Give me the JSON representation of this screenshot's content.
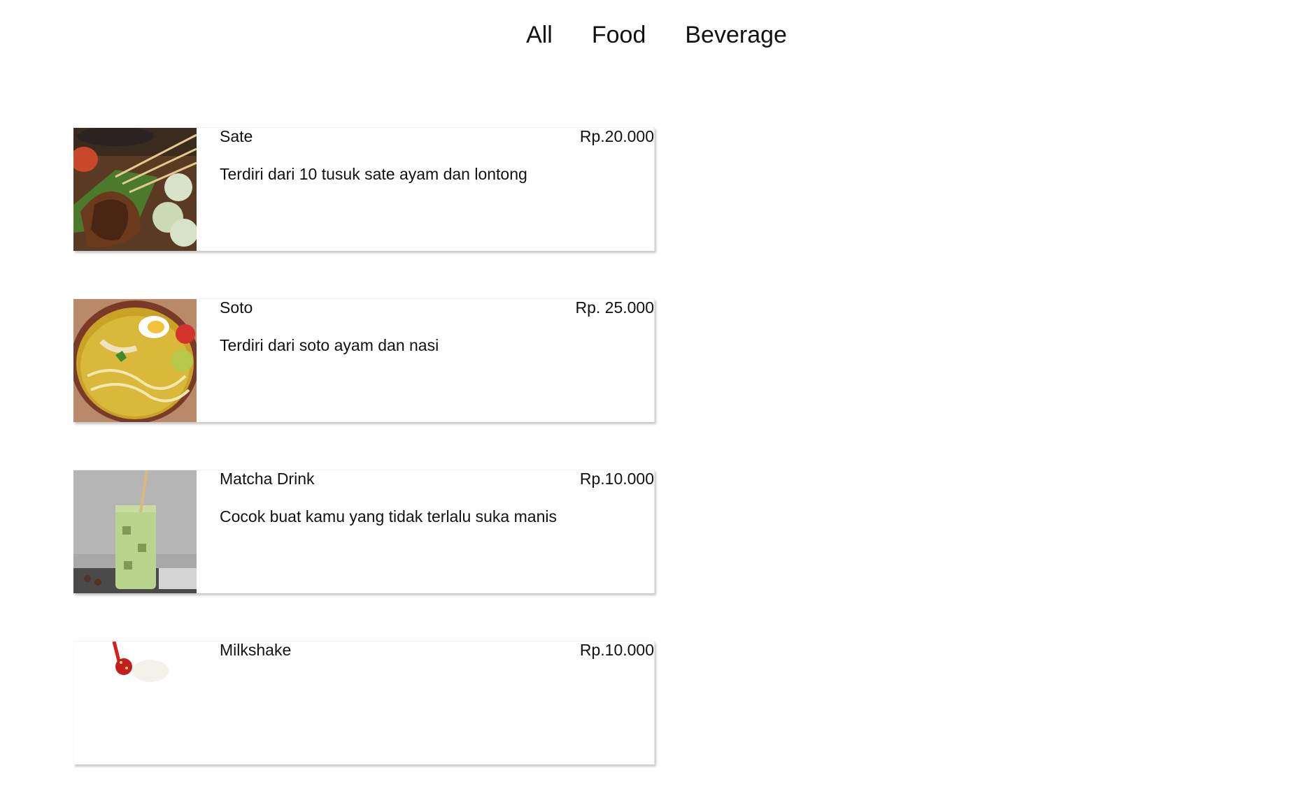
{
  "nav": {
    "tabs": [
      {
        "label": "All"
      },
      {
        "label": "Food"
      },
      {
        "label": "Beverage"
      }
    ]
  },
  "menu": {
    "items": [
      {
        "name": "Sate",
        "price": "Rp.20.000",
        "description": "Terdiri dari 10 tusuk sate ayam dan lontong",
        "image": "sate-photo"
      },
      {
        "name": "Soto",
        "price": "Rp. 25.000",
        "description": "Terdiri dari soto ayam dan nasi",
        "image": "soto-photo"
      },
      {
        "name": "Matcha Drink",
        "price": "Rp.10.000",
        "description": "Cocok buat kamu yang tidak terlalu suka manis",
        "image": "matcha-drink-photo"
      },
      {
        "name": "Milkshake",
        "price": "Rp.10.000",
        "description": "",
        "image": "milkshake-photo"
      }
    ]
  }
}
